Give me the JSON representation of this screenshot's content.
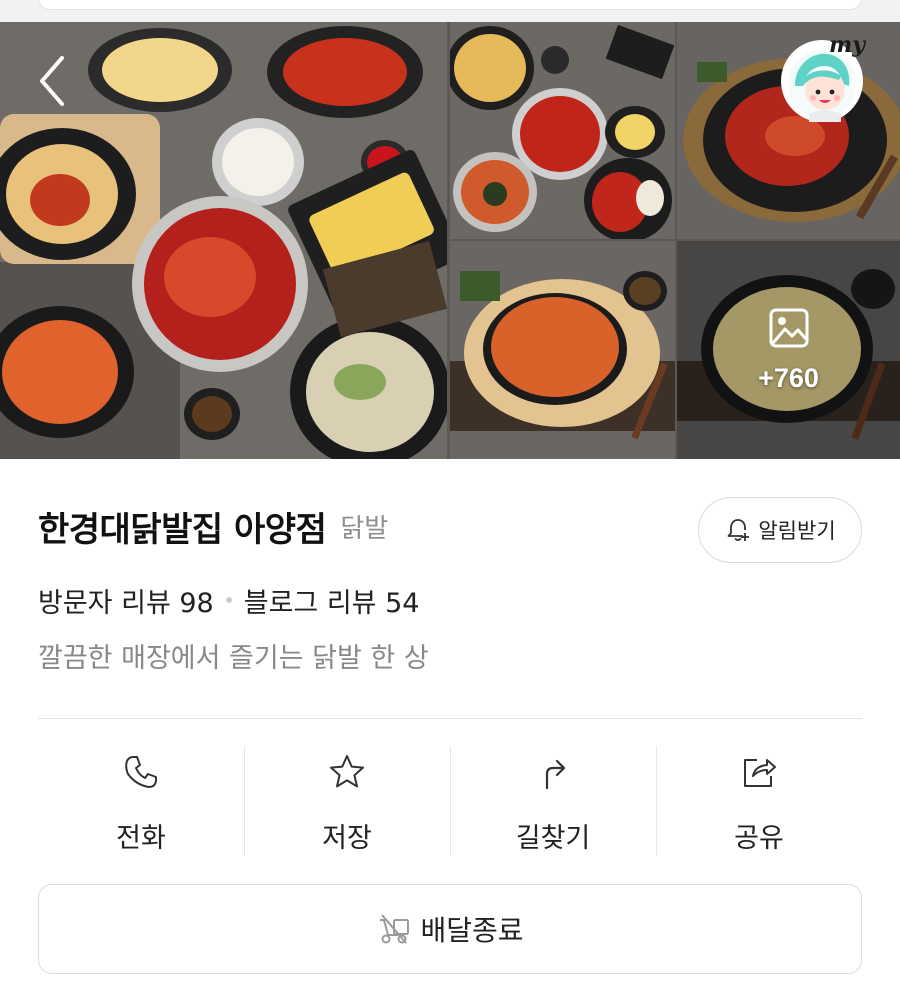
{
  "header": {
    "my_label": "my",
    "more_photos": "+760"
  },
  "place": {
    "name": "한경대닭발집 아양점",
    "category": "닭발",
    "alarm_label": "알림받기",
    "visitor_reviews": "방문자 리뷰 98",
    "blog_reviews": "블로그 리뷰 54",
    "tagline": "깔끔한 매장에서 즐기는 닭발 한 상"
  },
  "actions": [
    {
      "label": "전화",
      "icon": "phone-icon"
    },
    {
      "label": "저장",
      "icon": "star-icon"
    },
    {
      "label": "길찾기",
      "icon": "directions-icon"
    },
    {
      "label": "공유",
      "icon": "share-icon"
    }
  ],
  "delivery": {
    "label": "배달종료",
    "icon": "delivery-scooter-icon"
  },
  "colors": {
    "text_primary": "#111111",
    "text_secondary": "#888888",
    "border": "#dcdcdc",
    "photo_bg": "#6e6a66"
  }
}
